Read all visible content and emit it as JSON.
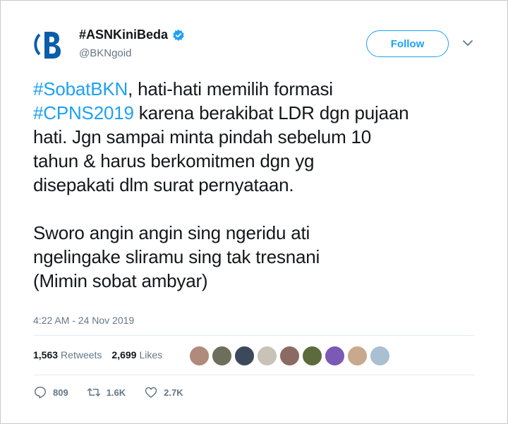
{
  "account": {
    "name": "#ASNKiniBeda",
    "handle": "@BKNgoid",
    "verified": true,
    "avatar_icon": "bkn-logo-icon",
    "avatar_letter": "B"
  },
  "follow_button": {
    "label": "Follow"
  },
  "tweet": {
    "lines": [
      [
        {
          "text": "#SobatBKN",
          "hashtag": true
        },
        {
          "text": ", hati-hati memilih formasi",
          "hashtag": false
        }
      ],
      [
        {
          "text": "#CPNS2019",
          "hashtag": true
        },
        {
          "text": " karena berakibat LDR dgn pujaan",
          "hashtag": false
        }
      ],
      [
        {
          "text": "hati. Jgn sampai minta pindah sebelum 10",
          "hashtag": false
        }
      ],
      [
        {
          "text": "tahun & harus berkomitmen dgn yg",
          "hashtag": false
        }
      ],
      [
        {
          "text": "disepakati dlm surat pernyataan.",
          "hashtag": false
        }
      ],
      [],
      [
        {
          "text": "Sworo angin angin sing ngeridu ati",
          "hashtag": false
        }
      ],
      [
        {
          "text": "ngelingake sliramu sing tak tresnani",
          "hashtag": false
        }
      ],
      [
        {
          "text": "(Mimin sobat ambyar)",
          "hashtag": false
        }
      ]
    ]
  },
  "timestamp": "4:22 AM - 24 Nov 2019",
  "stats": {
    "retweets_count": "1,563",
    "retweets_label": "Retweets",
    "likes_count": "2,699",
    "likes_label": "Likes"
  },
  "likers": [
    {
      "color": "#b08a7a"
    },
    {
      "color": "#6e6e5c"
    },
    {
      "color": "#3a4a5a"
    },
    {
      "color": "#c9c2b8"
    },
    {
      "color": "#8a6a62"
    },
    {
      "color": "#5d6b3c"
    },
    {
      "color": "#7a5ab5"
    },
    {
      "color": "#c7a98d"
    },
    {
      "color": "#a9bfd2"
    }
  ],
  "actions": {
    "reply_count": "809",
    "retweet_count": "1.6K",
    "like_count": "2.7K"
  },
  "colors": {
    "accent": "#1da1f2",
    "secondary_text": "#657786",
    "logo_blue": "#0a5ea8"
  }
}
